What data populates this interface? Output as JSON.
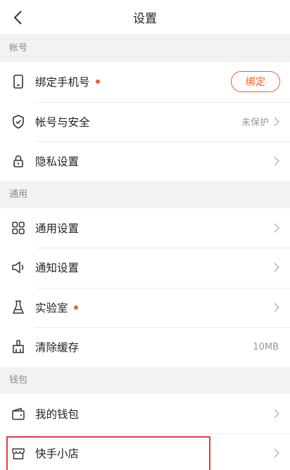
{
  "nav": {
    "title": "设置"
  },
  "sections": {
    "account": {
      "label": "帐号",
      "bind_phone": {
        "label": "绑定手机号",
        "button": "绑定"
      },
      "security": {
        "label": "帐号与安全",
        "value": "未保护"
      },
      "privacy": {
        "label": "隐私设置"
      }
    },
    "general": {
      "label": "通用",
      "general_settings": {
        "label": "通用设置"
      },
      "notifications": {
        "label": "通知设置"
      },
      "lab": {
        "label": "实验室"
      },
      "cache": {
        "label": "清除缓存",
        "value": "10MB"
      }
    },
    "wallet": {
      "label": "钱包",
      "my_wallet": {
        "label": "我的钱包"
      },
      "shop": {
        "label": "快手小店"
      }
    }
  },
  "colors": {
    "accent": "#e6622a",
    "highlight": "#e23a3a"
  }
}
